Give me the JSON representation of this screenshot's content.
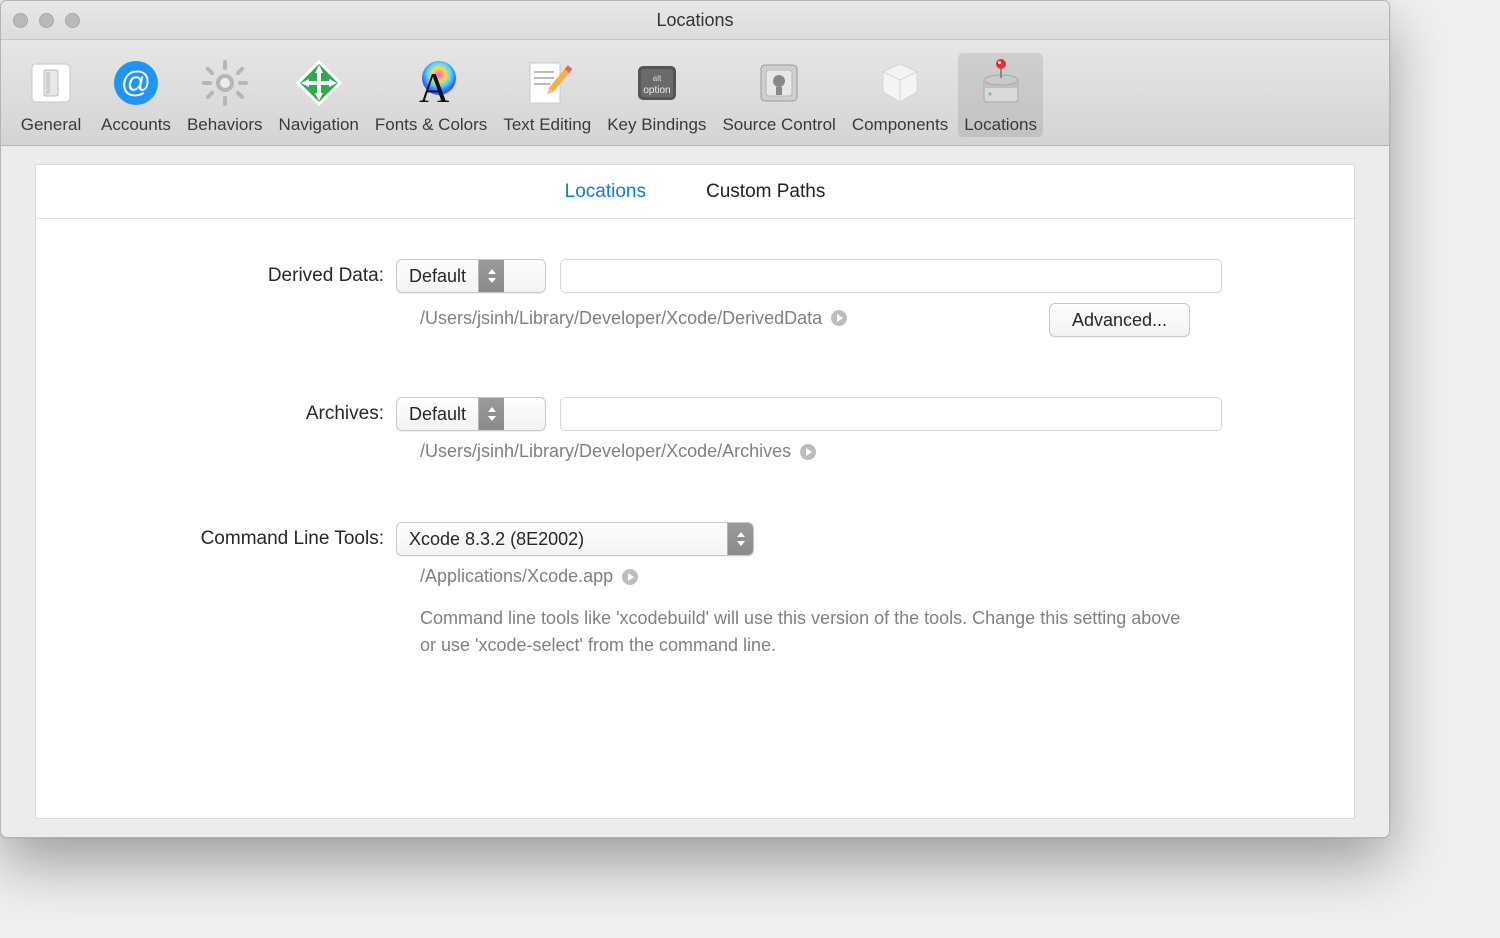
{
  "window": {
    "title": "Locations"
  },
  "toolbar": {
    "items": [
      {
        "label": "General"
      },
      {
        "label": "Accounts"
      },
      {
        "label": "Behaviors"
      },
      {
        "label": "Navigation"
      },
      {
        "label": "Fonts & Colors"
      },
      {
        "label": "Text Editing"
      },
      {
        "label": "Key Bindings"
      },
      {
        "label": "Source Control"
      },
      {
        "label": "Components"
      },
      {
        "label": "Locations"
      }
    ]
  },
  "tabs": {
    "locations": "Locations",
    "custom_paths": "Custom Paths"
  },
  "form": {
    "derived_data": {
      "label": "Derived Data:",
      "value": "Default",
      "path": "/Users/jsinh/Library/Developer/Xcode/DerivedData",
      "advanced": "Advanced..."
    },
    "archives": {
      "label": "Archives:",
      "value": "Default",
      "path": "/Users/jsinh/Library/Developer/Xcode/Archives"
    },
    "clt": {
      "label": "Command Line Tools:",
      "value": "Xcode 8.3.2 (8E2002)",
      "path": "/Applications/Xcode.app",
      "help": "Command line tools like 'xcodebuild' will use this version of the tools. Change this setting above or use 'xcode-select' from the command line."
    }
  }
}
